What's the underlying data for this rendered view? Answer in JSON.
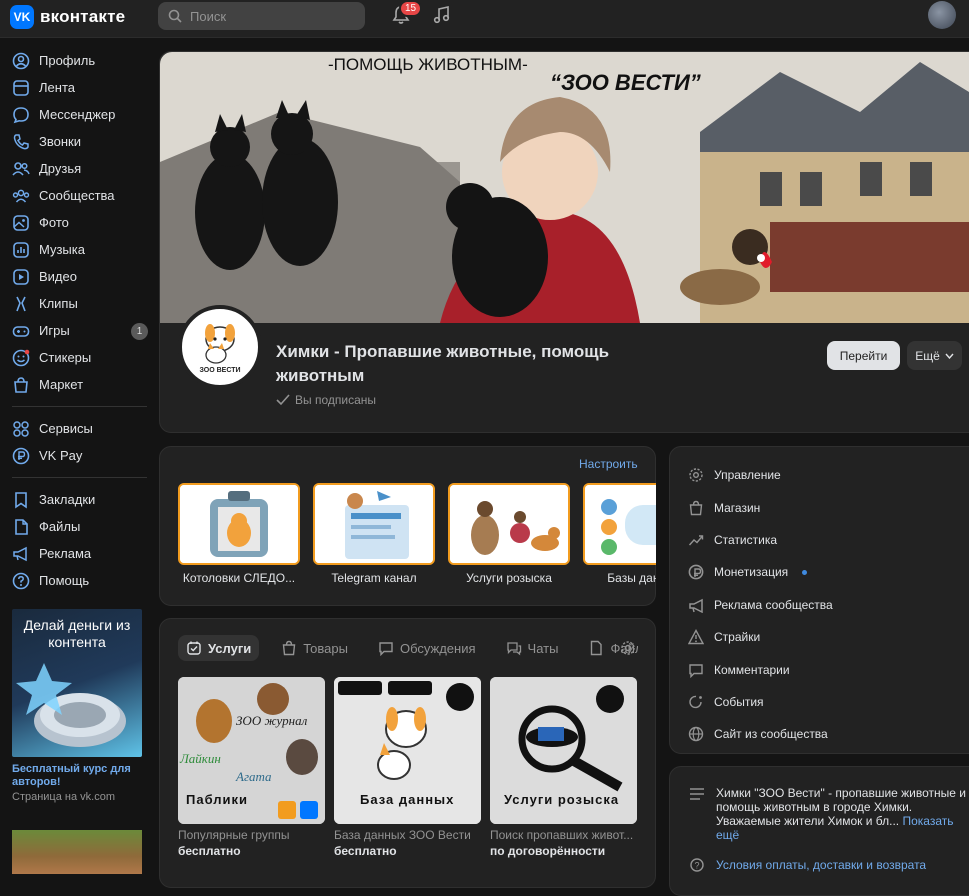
{
  "topbar": {
    "logo_text": "вконтакте",
    "search_placeholder": "Поиск",
    "notifications_count": "15"
  },
  "sidebar": {
    "items": [
      {
        "label": "Профиль",
        "icon": "user-icon"
      },
      {
        "label": "Лента",
        "icon": "news-icon"
      },
      {
        "label": "Мессенджер",
        "icon": "message-icon"
      },
      {
        "label": "Звонки",
        "icon": "phone-icon"
      },
      {
        "label": "Друзья",
        "icon": "friends-icon"
      },
      {
        "label": "Сообщества",
        "icon": "groups-icon"
      },
      {
        "label": "Фото",
        "icon": "photo-icon"
      },
      {
        "label": "Музыка",
        "icon": "music-icon"
      },
      {
        "label": "Видео",
        "icon": "video-icon"
      },
      {
        "label": "Клипы",
        "icon": "clips-icon"
      },
      {
        "label": "Игры",
        "icon": "games-icon",
        "badge": "1"
      },
      {
        "label": "Стикеры",
        "icon": "sticker-icon"
      },
      {
        "label": "Маркет",
        "icon": "market-icon"
      }
    ],
    "items2": [
      {
        "label": "Сервисы",
        "icon": "services-icon"
      },
      {
        "label": "VK Pay",
        "icon": "vkpay-icon"
      }
    ],
    "items3": [
      {
        "label": "Закладки",
        "icon": "bookmark-icon"
      },
      {
        "label": "Файлы",
        "icon": "file-icon"
      },
      {
        "label": "Реклама",
        "icon": "megaphone-icon"
      },
      {
        "label": "Помощь",
        "icon": "help-icon"
      }
    ],
    "ad": {
      "image_text": "Делай деньги из контента",
      "title": "Бесплатный курс для авторов!",
      "subtitle": "Страница на vk.com"
    }
  },
  "cover": {
    "caption_top": "-ПОМОЩЬ ЖИВОТНЫМ-",
    "caption_brand": "“ЗОО ВЕСТИ”"
  },
  "group": {
    "avatar_text": "ЗОО ВЕСТИ",
    "title": "Химки - Пропавшие животные, помощь животным",
    "subscribed": "Вы подписаны",
    "go_button": "Перейти",
    "more_button": "Ещё"
  },
  "links": {
    "settings": "Настроить",
    "items": [
      {
        "label": "Котоловки СЛЕДО..."
      },
      {
        "label": "Telegram канал"
      },
      {
        "label": "Услуги розыска"
      },
      {
        "label": "Базы данных"
      }
    ]
  },
  "tabs": [
    {
      "label": "Услуги",
      "icon": "services-check-icon",
      "active": true
    },
    {
      "label": "Товары",
      "icon": "bag-icon"
    },
    {
      "label": "Обсуждения",
      "icon": "discussion-icon"
    },
    {
      "label": "Чаты",
      "icon": "chat-icon"
    },
    {
      "label": "Файлы",
      "icon": "file-icon"
    }
  ],
  "services": [
    {
      "name": "Популярные группы",
      "price": "бесплатно",
      "image_text": "Паблики",
      "image_lines": [
        "ЗОО журнал",
        "Лайкин",
        "Агата"
      ]
    },
    {
      "name": "База данных ЗОО Вести",
      "price": "бесплатно",
      "image_text": "База данных"
    },
    {
      "name": "Поиск пропавших живот...",
      "price": "по договорённости",
      "image_text": "Услуги розыска"
    }
  ],
  "menu": [
    {
      "label": "Управление",
      "icon": "gear-icon"
    },
    {
      "label": "Магазин",
      "icon": "shop-icon"
    },
    {
      "label": "Статистика",
      "icon": "stats-icon"
    },
    {
      "label": "Монетизация",
      "icon": "money-icon",
      "dot": true
    },
    {
      "label": "Реклама сообщества",
      "icon": "megaphone-icon"
    },
    {
      "label": "Страйки",
      "icon": "warning-icon"
    },
    {
      "label": "Комментарии",
      "icon": "comment-icon"
    },
    {
      "label": "События",
      "icon": "event-icon"
    },
    {
      "label": "Сайт из сообщества",
      "icon": "globe-icon"
    }
  ],
  "description": {
    "text": "Химки \"ЗОО Вести\" - пропавшие животные и помощь животным в городе Химки. Уважаемые жители Химок и бл...",
    "show_more": "Показать ещё",
    "terms": "Условия оплаты, доставки и возврата"
  },
  "colors": {
    "accent": "#0077ff",
    "link": "#71aaeb",
    "tile_border": "#f29c1f",
    "badge_red": "#e64646"
  }
}
